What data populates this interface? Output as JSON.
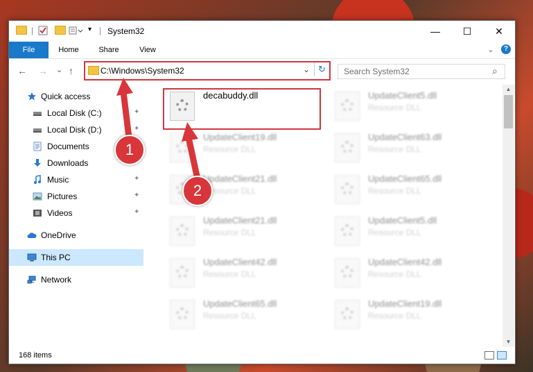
{
  "window": {
    "title": "System32",
    "minimize_symbol": "—",
    "maximize_symbol": "☐",
    "close_symbol": "✕"
  },
  "ribbon": {
    "tabs": [
      "File",
      "Home",
      "Share",
      "View"
    ],
    "expand_symbol": "⌄",
    "help_symbol": "?"
  },
  "nav": {
    "back_symbol": "←",
    "forward_symbol": "→",
    "recent_symbol": "⌄",
    "up_symbol": "↑",
    "address": "C:\\Windows\\System32",
    "address_dropdown": "⌄",
    "refresh_symbol": "↻",
    "search_placeholder": "Search System32",
    "search_icon": "⌕"
  },
  "sidebar": {
    "items": [
      {
        "label": "Quick access",
        "icon": "star-icon"
      },
      {
        "label": "Local Disk (C:)",
        "icon": "drive-icon",
        "pinned": true
      },
      {
        "label": "Local Disk (D:)",
        "icon": "drive-icon",
        "pinned": true
      },
      {
        "label": "Documents",
        "icon": "document-icon",
        "pinned": true
      },
      {
        "label": "Downloads",
        "icon": "download-icon",
        "pinned": true
      },
      {
        "label": "Music",
        "icon": "music-icon",
        "pinned": true
      },
      {
        "label": "Pictures",
        "icon": "picture-icon",
        "pinned": true
      },
      {
        "label": "Videos",
        "icon": "video-icon",
        "pinned": true
      },
      {
        "label": "OneDrive",
        "icon": "cloud-icon"
      },
      {
        "label": "This PC",
        "icon": "computer-icon",
        "selected": true
      },
      {
        "label": "Network",
        "icon": "network-icon"
      }
    ],
    "pin_symbol": "📌"
  },
  "files": {
    "left": [
      {
        "name": "decabuddy.dll",
        "type": ""
      },
      {
        "name": "UpdateClient19.dll",
        "type": "Resource DLL"
      },
      {
        "name": "UpdateClient21.dll",
        "type": "Resource DLL"
      },
      {
        "name": "UpdateClient21.dll",
        "type": "Resource DLL"
      },
      {
        "name": "UpdateClient42.dll",
        "type": "Resource DLL"
      },
      {
        "name": "UpdateClient65.dll",
        "type": "Resource DLL"
      }
    ],
    "right": [
      {
        "name": "UpdateClient5.dll",
        "type": "Resource DLL"
      },
      {
        "name": "UpdateClient63.dll",
        "type": "Resource DLL"
      },
      {
        "name": "UpdateClient65.dll",
        "type": "Resource DLL"
      },
      {
        "name": "UpdateClient5.dll",
        "type": "Resource DLL"
      },
      {
        "name": "UpdateClient42.dll",
        "type": "Resource DLL"
      },
      {
        "name": "UpdateClient19.dll",
        "type": "Resource DLL"
      }
    ]
  },
  "status": {
    "item_count": "168 items"
  },
  "annotations": {
    "step1": "1",
    "step2": "2",
    "color": "#d8363a"
  }
}
